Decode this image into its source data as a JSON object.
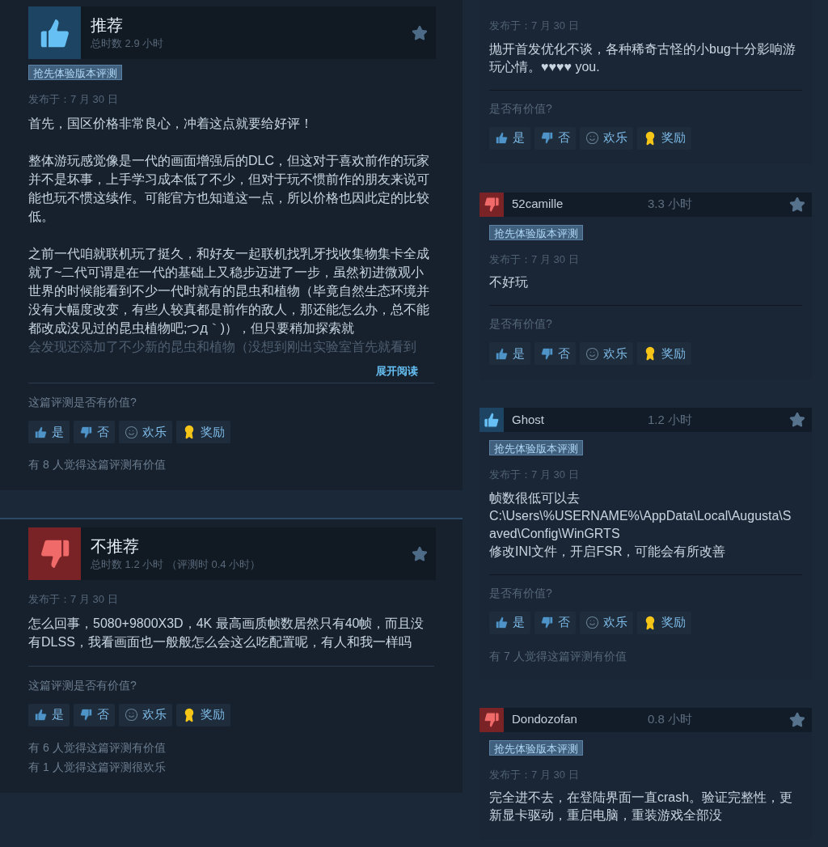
{
  "left_reviews": [
    {
      "kind": "thumbs_up",
      "title": "推荐",
      "hours": "总时数 2.9 小时",
      "tag": "抢先体验版本评测",
      "date": "发布于：7 月 30 日",
      "paragraphs": [
        "首先，国区价格非常良心，冲着这点就要给好评！",
        "整体游玩感觉像是一代的画面增强后的DLC，但这对于喜欢前作的玩家并不是坏事，上手学习成本低了不少，但对于玩不惯前作的朋友来说可能也玩不惯这续作。可能官方也知道这一点，所以价格也因此定的比较低。",
        "之前一代咱就联机玩了挺久，和好友一起联机找乳牙找收集物集卡全成就了~二代可谓是在一代的基础上又稳步迈进了一步，虽然初进微观小世界的时候能看到不少一代时就有的昆虫和植物（毕竟自然生态环境并没有大幅度改变，有些人较真都是前作的敌人，那还能怎么办，总不能都改成没见过的昆虫植物吧;つд｀)），但只要稍加探索就"
      ],
      "faded_line": "会发现还添加了不少新的昆虫和植物（没想到刚出实验室首先就看到",
      "expand_link": "展开阅读",
      "question": "这篇评测是否有价值?",
      "buttons": [
        {
          "kind": "yes",
          "label": "是"
        },
        {
          "kind": "no",
          "label": "否"
        },
        {
          "kind": "funny",
          "label": "欢乐"
        },
        {
          "kind": "award",
          "label": "奖励"
        }
      ],
      "counts": [
        "有 8 人觉得这篇评测有价值"
      ]
    },
    {
      "kind": "thumbs_down",
      "title": "不推荐",
      "hours": "总时数 1.2 小时 （评测时 0.4 小时）",
      "date": "发布于：7 月 30 日",
      "paragraphs": [
        "怎么回事，5080+9800X3D，4K 最高画质帧数居然只有40帧，而且没有DLSS，我看画面也一般般怎么会这么吃配置呢，有人和我一样吗"
      ],
      "question": "这篇评测是否有价值?",
      "buttons": [
        {
          "kind": "yes",
          "label": "是"
        },
        {
          "kind": "no",
          "label": "否"
        },
        {
          "kind": "funny",
          "label": "欢乐"
        },
        {
          "kind": "award",
          "label": "奖励"
        }
      ],
      "counts": [
        "有 6 人觉得这篇评测有价值",
        "有 1 人觉得这篇评测很欢乐"
      ]
    }
  ],
  "right_reviews": [
    {
      "date": "发布于：7 月 30 日",
      "lines": [
        "抛开首发优化不谈，各种稀奇古怪的小bug十分影响游玩心情。♥♥♥♥ you."
      ],
      "question": "是否有价值?",
      "buttons": [
        {
          "kind": "yes",
          "label": "是"
        },
        {
          "kind": "no",
          "label": "否"
        },
        {
          "kind": "funny",
          "label": "欢乐"
        },
        {
          "kind": "award",
          "label": "奖励"
        }
      ]
    },
    {
      "kind": "thumbs_down",
      "author": "52camille",
      "hours": "3.3 小时",
      "tag": "抢先体验版本评测",
      "date": "发布于：7 月 30 日",
      "lines": [
        "不好玩"
      ],
      "question": "是否有价值?",
      "buttons": [
        {
          "kind": "yes",
          "label": "是"
        },
        {
          "kind": "no",
          "label": "否"
        },
        {
          "kind": "funny",
          "label": "欢乐"
        },
        {
          "kind": "award",
          "label": "奖励"
        }
      ]
    },
    {
      "kind": "thumbs_up",
      "author": "Ghost",
      "hours": "1.2 小时",
      "tag": "抢先体验版本评测",
      "date": "发布于：7 月 30 日",
      "lines": [
        "帧数很低可以去",
        "C:\\Users\\%USERNAME%\\AppData\\Local\\Augusta\\Saved\\Config\\WinGRTS",
        "修改INI文件，开启FSR，可能会有所改善"
      ],
      "question": "是否有价值?",
      "buttons": [
        {
          "kind": "yes",
          "label": "是"
        },
        {
          "kind": "no",
          "label": "否"
        },
        {
          "kind": "funny",
          "label": "欢乐"
        },
        {
          "kind": "award",
          "label": "奖励"
        }
      ],
      "counts": [
        "有 7 人觉得这篇评测有价值"
      ]
    },
    {
      "kind": "thumbs_down",
      "author": "Dondozofan",
      "hours": "0.8 小时",
      "tag": "抢先体验版本评测",
      "date": "发布于：7 月 30 日",
      "lines": [
        "完全进不去，在登陆界面一直crash。验证完整性，更新显卡驱动，重启电脑，重装游戏全部没"
      ]
    }
  ]
}
